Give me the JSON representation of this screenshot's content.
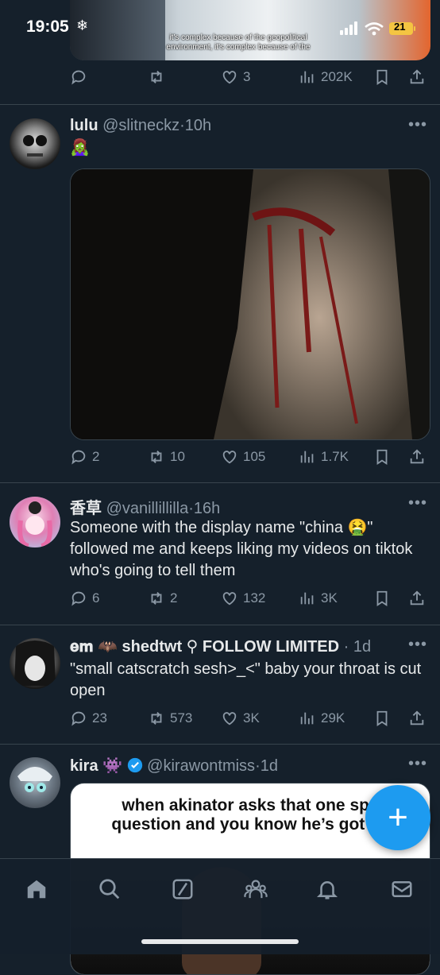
{
  "status_bar": {
    "time": "19:05",
    "battery": "21"
  },
  "top_post": {
    "caption_line1": "it's complex because of the geopolitical",
    "caption_line2": "environment, it's complex because of the",
    "likes": "3",
    "views": "202K"
  },
  "posts": [
    {
      "name": "lulu",
      "handle": "@slitneckz",
      "time": "10h",
      "emoji": "🧟‍♀️",
      "replies": "2",
      "reposts": "10",
      "likes": "105",
      "views": "1.7K"
    },
    {
      "name": "香草",
      "handle": "@vanillillilla",
      "time": "16h",
      "text": "Someone with the display name \"china 🤮\" followed me and keeps liking my videos on tiktok who's going to tell them",
      "replies": "6",
      "reposts": "2",
      "likes": "132",
      "views": "3K"
    },
    {
      "name": "𝐞𝐦 🦇 shedtwt ⚲ FOLLOW LIMITED",
      "handle": "",
      "time": "1d",
      "text": "\"small catscratch sesh>_<\" baby your throat is cut open",
      "replies": "23",
      "reposts": "573",
      "likes": "3K",
      "views": "29K"
    },
    {
      "name": "kira 👾",
      "handle": "@kirawontmiss",
      "time": "1d",
      "meme_line1": "when akinator asks that one spe",
      "meme_line2": "question and you know he’s got yo"
    }
  ],
  "icons": [
    "reply-icon",
    "repost-icon",
    "like-icon",
    "views-icon",
    "bookmark-icon",
    "share-icon",
    "more-icon",
    "verified-icon",
    "home-icon",
    "search-icon",
    "grok-icon",
    "communities-icon",
    "notifications-icon",
    "messages-icon",
    "compose-plus-icon"
  ],
  "colors": {
    "background": "#15202b",
    "accent": "#1d9bf0",
    "muted": "#8b98a5"
  }
}
